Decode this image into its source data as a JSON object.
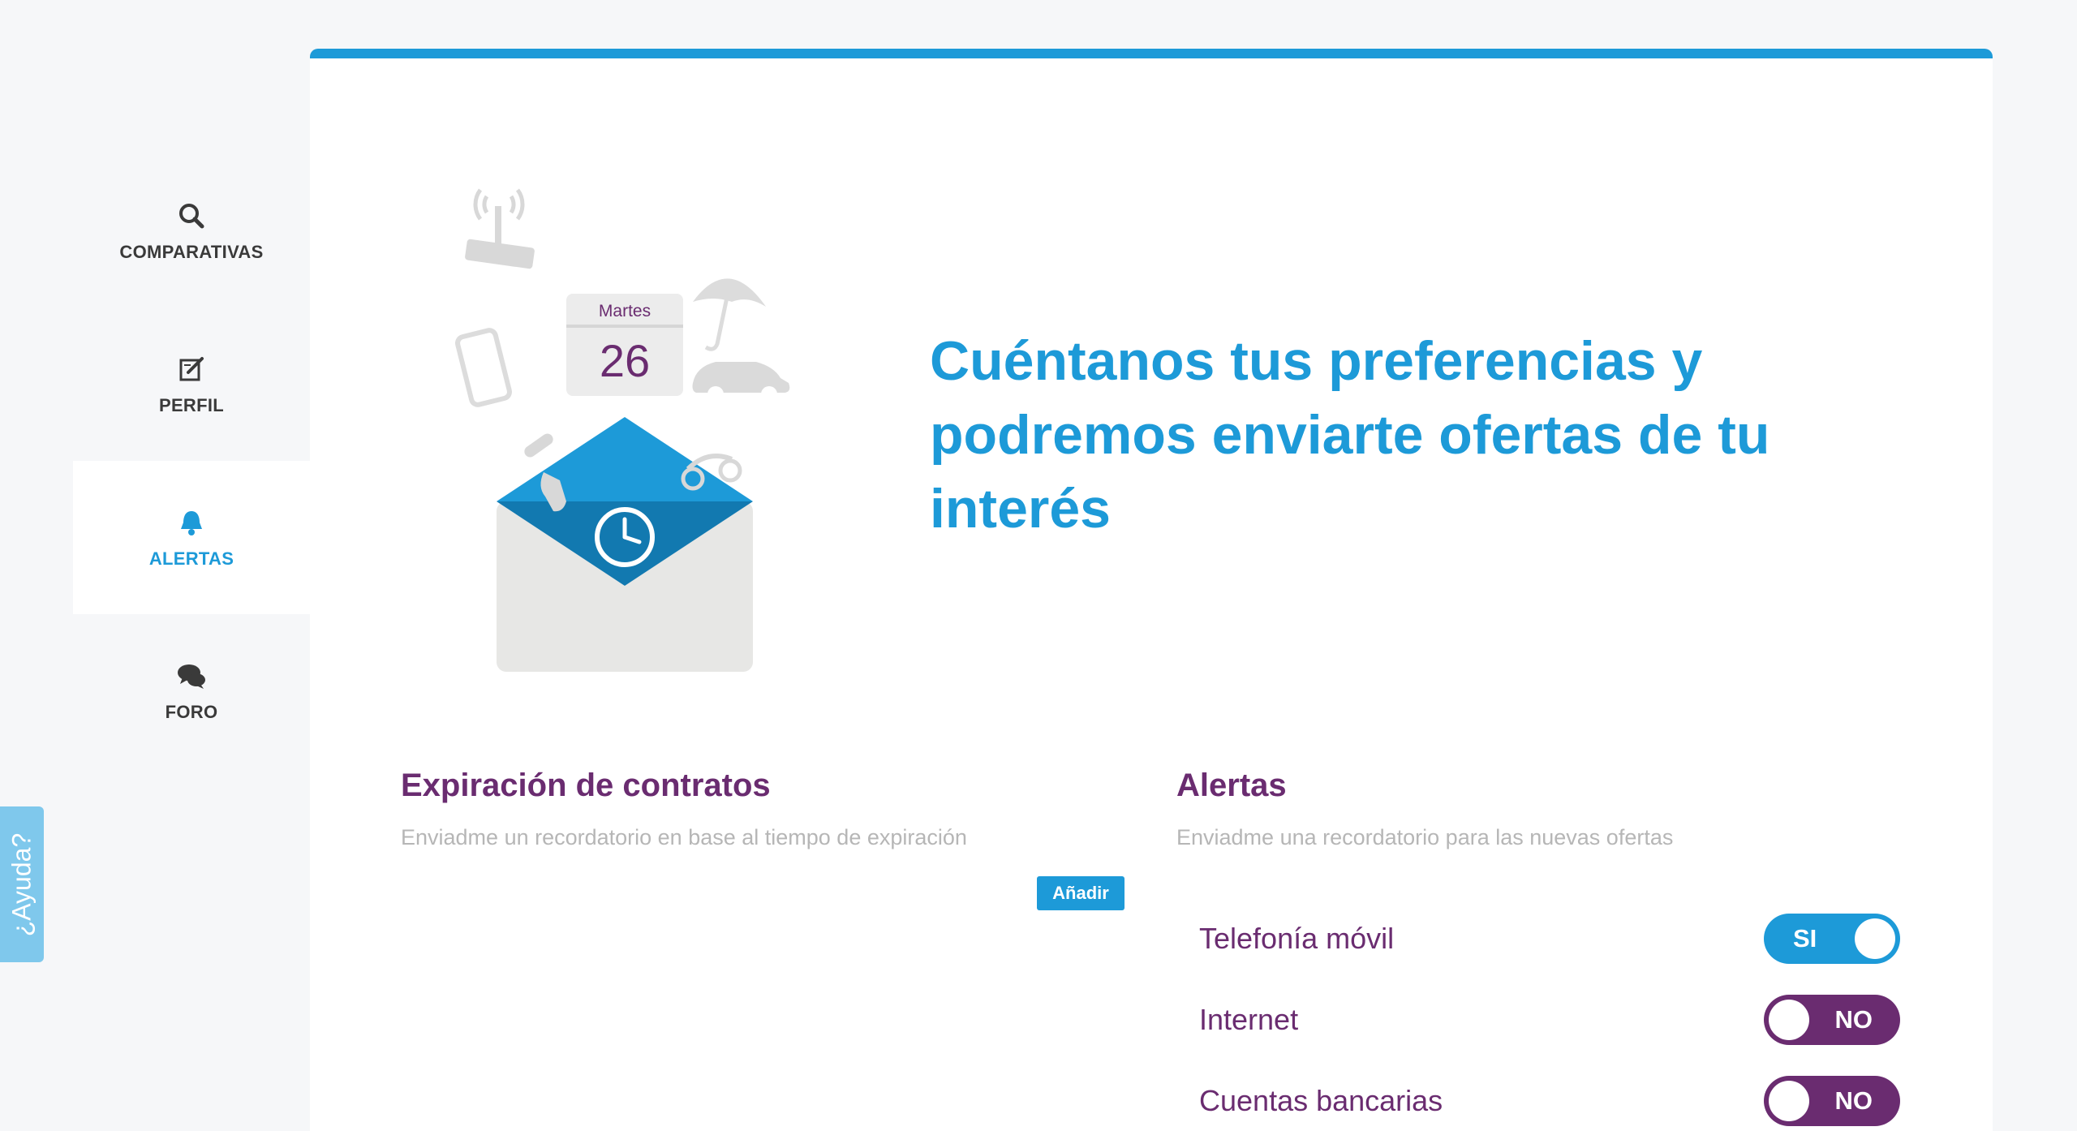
{
  "sidebar": {
    "items": [
      {
        "label": "COMPARATIVAS",
        "icon": "search-icon",
        "active": false
      },
      {
        "label": "PERFIL",
        "icon": "edit-icon",
        "active": false
      },
      {
        "label": "ALERTAS",
        "icon": "bell-icon",
        "active": true
      },
      {
        "label": "FORO",
        "icon": "chat-icon",
        "active": false
      }
    ]
  },
  "help": {
    "label": "¿Ayuda?"
  },
  "illustration": {
    "calendar_day_name": "Martes",
    "calendar_day_number": "26"
  },
  "headline": "Cuéntanos tus preferencias y podremos enviarte ofertas de tu interés",
  "expiration": {
    "title": "Expiración de contratos",
    "description": "Enviadme un recordatorio en base al tiempo de expiración",
    "add_button": "Añadir"
  },
  "alerts": {
    "title": "Alertas",
    "description": "Enviadme una recordatorio para las nuevas ofertas",
    "items": [
      {
        "label": "Telefonía móvil",
        "state": "SI"
      },
      {
        "label": "Internet",
        "state": "NO"
      },
      {
        "label": "Cuentas bancarias",
        "state": "NO"
      }
    ]
  },
  "colors": {
    "accent": "#1d9ad8",
    "brand_purple": "#6a2c70",
    "muted_text": "#b6b6b6"
  }
}
